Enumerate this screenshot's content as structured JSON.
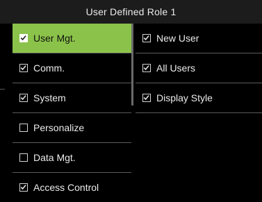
{
  "title": "User Defined Role 1",
  "left_menu": {
    "items": [
      {
        "label": "User Mgt.",
        "checked": true,
        "selected": true
      },
      {
        "label": "Comm.",
        "checked": true,
        "selected": false
      },
      {
        "label": "System",
        "checked": true,
        "selected": false
      },
      {
        "label": "Personalize",
        "checked": false,
        "selected": false
      },
      {
        "label": "Data Mgt.",
        "checked": false,
        "selected": false
      },
      {
        "label": "Access Control",
        "checked": true,
        "selected": false
      }
    ]
  },
  "right_menu": {
    "items": [
      {
        "label": "New User",
        "checked": true
      },
      {
        "label": "All Users",
        "checked": true
      },
      {
        "label": "Display Style",
        "checked": true
      }
    ]
  },
  "colors": {
    "selected_background": "#8bc34a",
    "background": "#000000",
    "title_background": "#1c1c1c"
  },
  "icons": {
    "checked": "checkbox-checked-icon",
    "unchecked": "checkbox-unchecked-icon"
  }
}
